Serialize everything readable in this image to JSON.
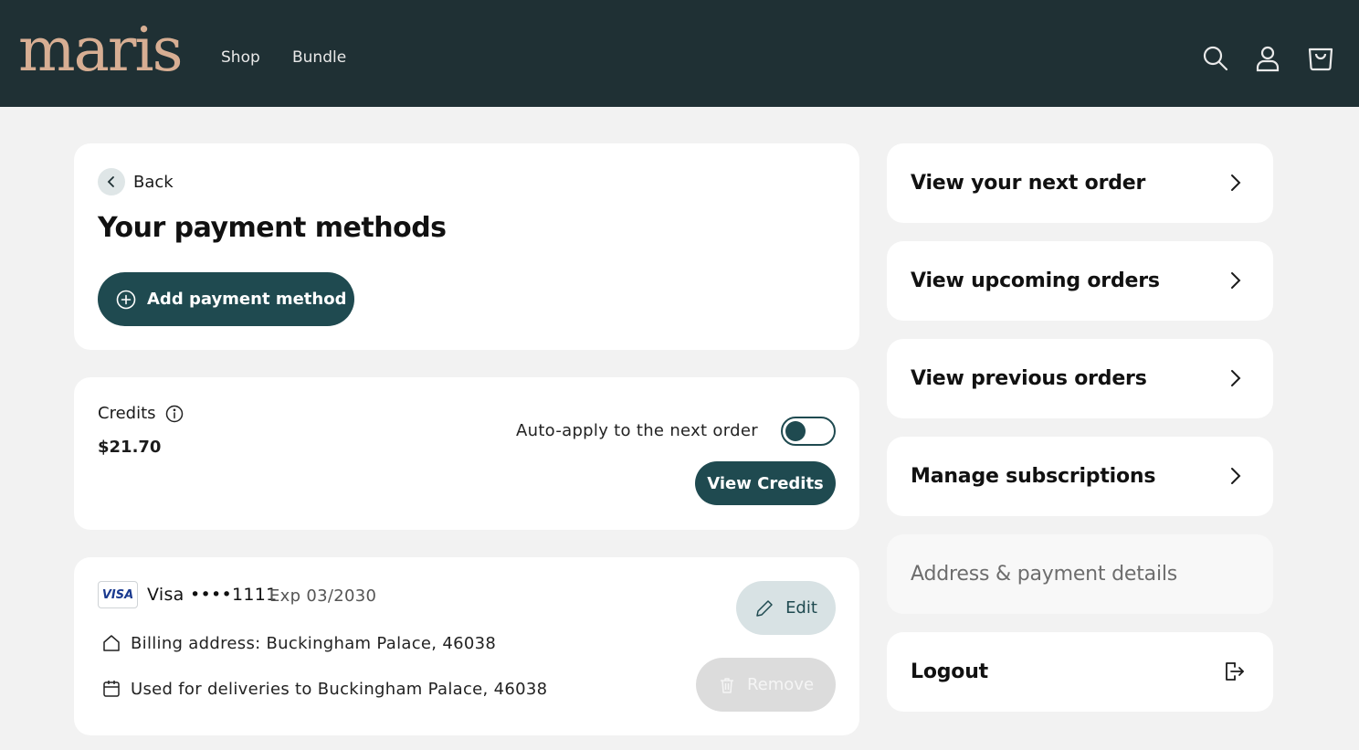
{
  "header": {
    "logo": "maris",
    "nav": [
      "Shop",
      "Bundle"
    ],
    "icons": [
      "search-icon",
      "account-icon",
      "cart-icon"
    ]
  },
  "payment": {
    "back_label": "Back",
    "title": "Your payment methods",
    "add_button": "Add payment method"
  },
  "credits": {
    "label": "Credits",
    "amount": "$21.70",
    "auto_apply_label": "Auto-apply to the next order",
    "auto_apply_on": true,
    "view_button": "View Credits"
  },
  "card": {
    "brand_badge": "VISA",
    "brand": "Visa",
    "masked_number": "••••1111",
    "expiry": "Exp 03/2030",
    "billing": "Billing address: Buckingham Palace, 46038",
    "deliveries": "Used for deliveries to Buckingham Palace, 46038",
    "edit_button": "Edit",
    "remove_button": "Remove"
  },
  "menu": {
    "items": [
      {
        "label": "View your next order"
      },
      {
        "label": "View upcoming orders"
      },
      {
        "label": "View previous orders"
      },
      {
        "label": "Manage subscriptions"
      },
      {
        "label": "Address & payment details",
        "active": true
      },
      {
        "label": "Logout"
      }
    ]
  },
  "colors": {
    "header_bg": "#1f3034",
    "logo": "#d7ae93",
    "primary": "#1f4a50",
    "page_bg": "#f2f2f2"
  }
}
